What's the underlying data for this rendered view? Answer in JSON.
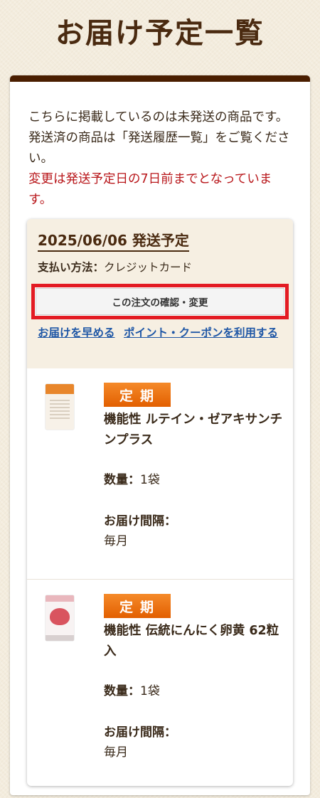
{
  "page": {
    "title": "お届け予定一覧"
  },
  "intro": {
    "text": "こちらに掲載しているのは未発送の商品です。発送済の商品は「発送履歴一覧」をご覧ください。",
    "notice": "変更は発送予定日の7日前までとなっています。"
  },
  "order": {
    "ship_date": "2025/06/06 発送予定",
    "payment_label": "支払い方法：",
    "payment_value": "クレジットカード",
    "confirm_button": "この注文の確認・変更",
    "links": {
      "expedite": "お届けを早める",
      "points": "ポイント・クーポンを利用する"
    }
  },
  "products": [
    {
      "badge": "定期",
      "name": "機能性 ルテイン・ゼアキサンチンプラス",
      "qty_label": "数量：",
      "qty_value": "1袋",
      "interval_label": "お届け間隔：",
      "interval_value": "毎月"
    },
    {
      "badge": "定期",
      "name": "機能性 伝統にんにく卵黄 62粒入",
      "qty_label": "数量：",
      "qty_value": "1袋",
      "interval_label": "お届け間隔：",
      "interval_value": "毎月"
    }
  ],
  "colors": {
    "card_top": "#4a1e00",
    "badge": "#f07a1a",
    "link": "#1f57a6",
    "notice": "#b8161a",
    "highlight": "#e31b23"
  }
}
